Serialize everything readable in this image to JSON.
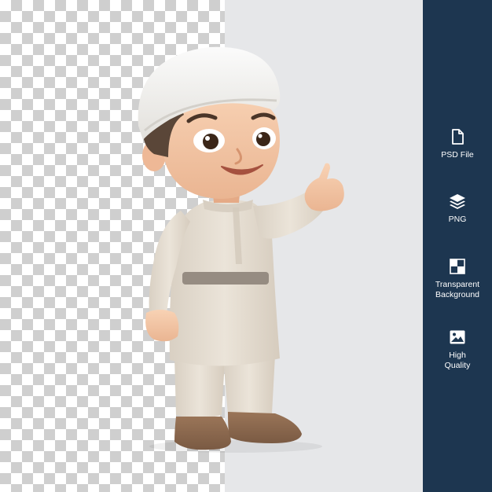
{
  "features": [
    {
      "icon": "file-icon",
      "label": "PSD File"
    },
    {
      "icon": "layers-icon",
      "label": "PNG"
    },
    {
      "icon": "transparency-grid-icon",
      "label": "Transparent\nBackground"
    },
    {
      "icon": "image-icon",
      "label": "High\nQuality"
    }
  ],
  "colors": {
    "sidebar": "#1d3650",
    "preview_background": "#e6e7e9",
    "checker_dark": "#cfcfcf",
    "checker_light": "#ffffff"
  }
}
